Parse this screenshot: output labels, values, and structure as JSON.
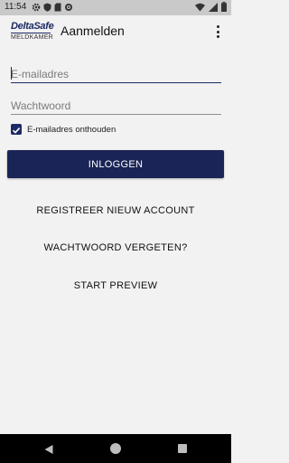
{
  "status_bar": {
    "time": "11:54",
    "left_icons": [
      "gear-icon",
      "shield-icon",
      "sd-card-icon",
      "sync-icon"
    ],
    "right_icons": [
      "wifi-icon",
      "signal-icon",
      "battery-icon"
    ]
  },
  "app_bar": {
    "logo_top": "DeltaSafe",
    "logo_bottom": "MELDKAMER",
    "title": "Aanmelden"
  },
  "form": {
    "email_placeholder": "E-mailadres",
    "email_value": "",
    "password_placeholder": "Wachtwoord",
    "password_value": "",
    "remember_label": "E-mailadres onthouden",
    "remember_checked": true
  },
  "buttons": {
    "login": "INLOGGEN",
    "register": "REGISTREER NIEUW ACCOUNT",
    "forgot": "WACHTWOORD VERGETEN?",
    "preview": "START PREVIEW"
  },
  "colors": {
    "primary": "#1a2456",
    "background": "#f2f2f2",
    "status_bar": "#c9c9c9",
    "nav_bar": "#000000"
  }
}
